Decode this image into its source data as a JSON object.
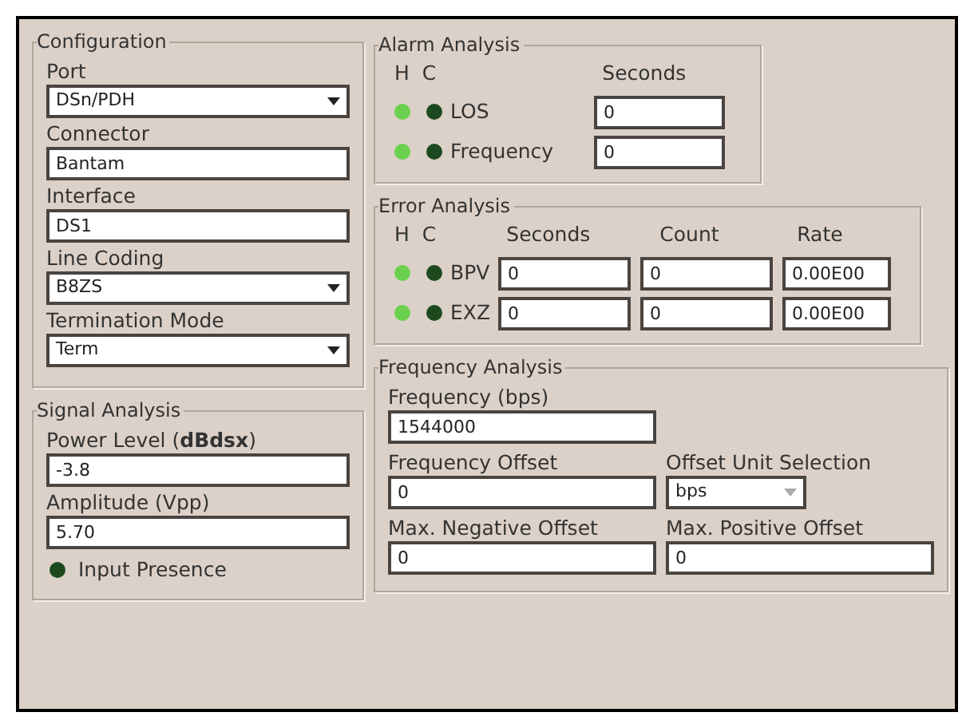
{
  "configuration": {
    "title": "Configuration",
    "fields": [
      {
        "kind": "dropdown",
        "label": "Port",
        "value": "DSn/PDH"
      },
      {
        "kind": "text",
        "label": "Connector",
        "value": "Bantam"
      },
      {
        "kind": "text",
        "label": "Interface",
        "value": "DS1"
      },
      {
        "kind": "dropdown",
        "label": "Line Coding",
        "value": "B8ZS"
      },
      {
        "kind": "dropdown",
        "label": "Termination Mode",
        "value": "Term"
      }
    ]
  },
  "signal_analysis": {
    "title": "Signal Analysis",
    "fields": [
      {
        "label": "Power Level (**dBdsx**)",
        "value": "-3.8"
      },
      {
        "label": "Amplitude (Vpp)",
        "value": "5.70"
      }
    ],
    "indicator": {
      "label": "Input Presence",
      "on": false
    }
  },
  "alarm_analysis": {
    "title": "Alarm Analysis",
    "columns": [
      "H",
      "C",
      "Seconds"
    ],
    "rows": [
      {
        "label": "LOS",
        "h_on": true,
        "c_on": false,
        "seconds": "0"
      },
      {
        "label": "Frequency",
        "h_on": true,
        "c_on": false,
        "seconds": "0"
      }
    ]
  },
  "error_analysis": {
    "title": "Error Analysis",
    "columns": [
      "H",
      "C",
      "Seconds",
      "Count",
      "Rate"
    ],
    "rows": [
      {
        "label": "BPV",
        "h_on": true,
        "c_on": false,
        "seconds": "0",
        "count": "0",
        "rate": "0.00E00"
      },
      {
        "label": "EXZ",
        "h_on": true,
        "c_on": false,
        "seconds": "0",
        "count": "0",
        "rate": "0.00E00"
      }
    ]
  },
  "frequency_analysis": {
    "title": "Frequency Analysis",
    "frequency": {
      "label": "Frequency (bps)",
      "value": "1544000"
    },
    "offset": {
      "label": "Frequency Offset",
      "value": "0"
    },
    "unit": {
      "label": "Offset Unit Selection",
      "value": "bps",
      "disabled": true
    },
    "max_negative": {
      "label": "Max. Negative Offset",
      "value": "0"
    },
    "max_positive": {
      "label": "Max. Positive Offset",
      "value": "0"
    }
  }
}
